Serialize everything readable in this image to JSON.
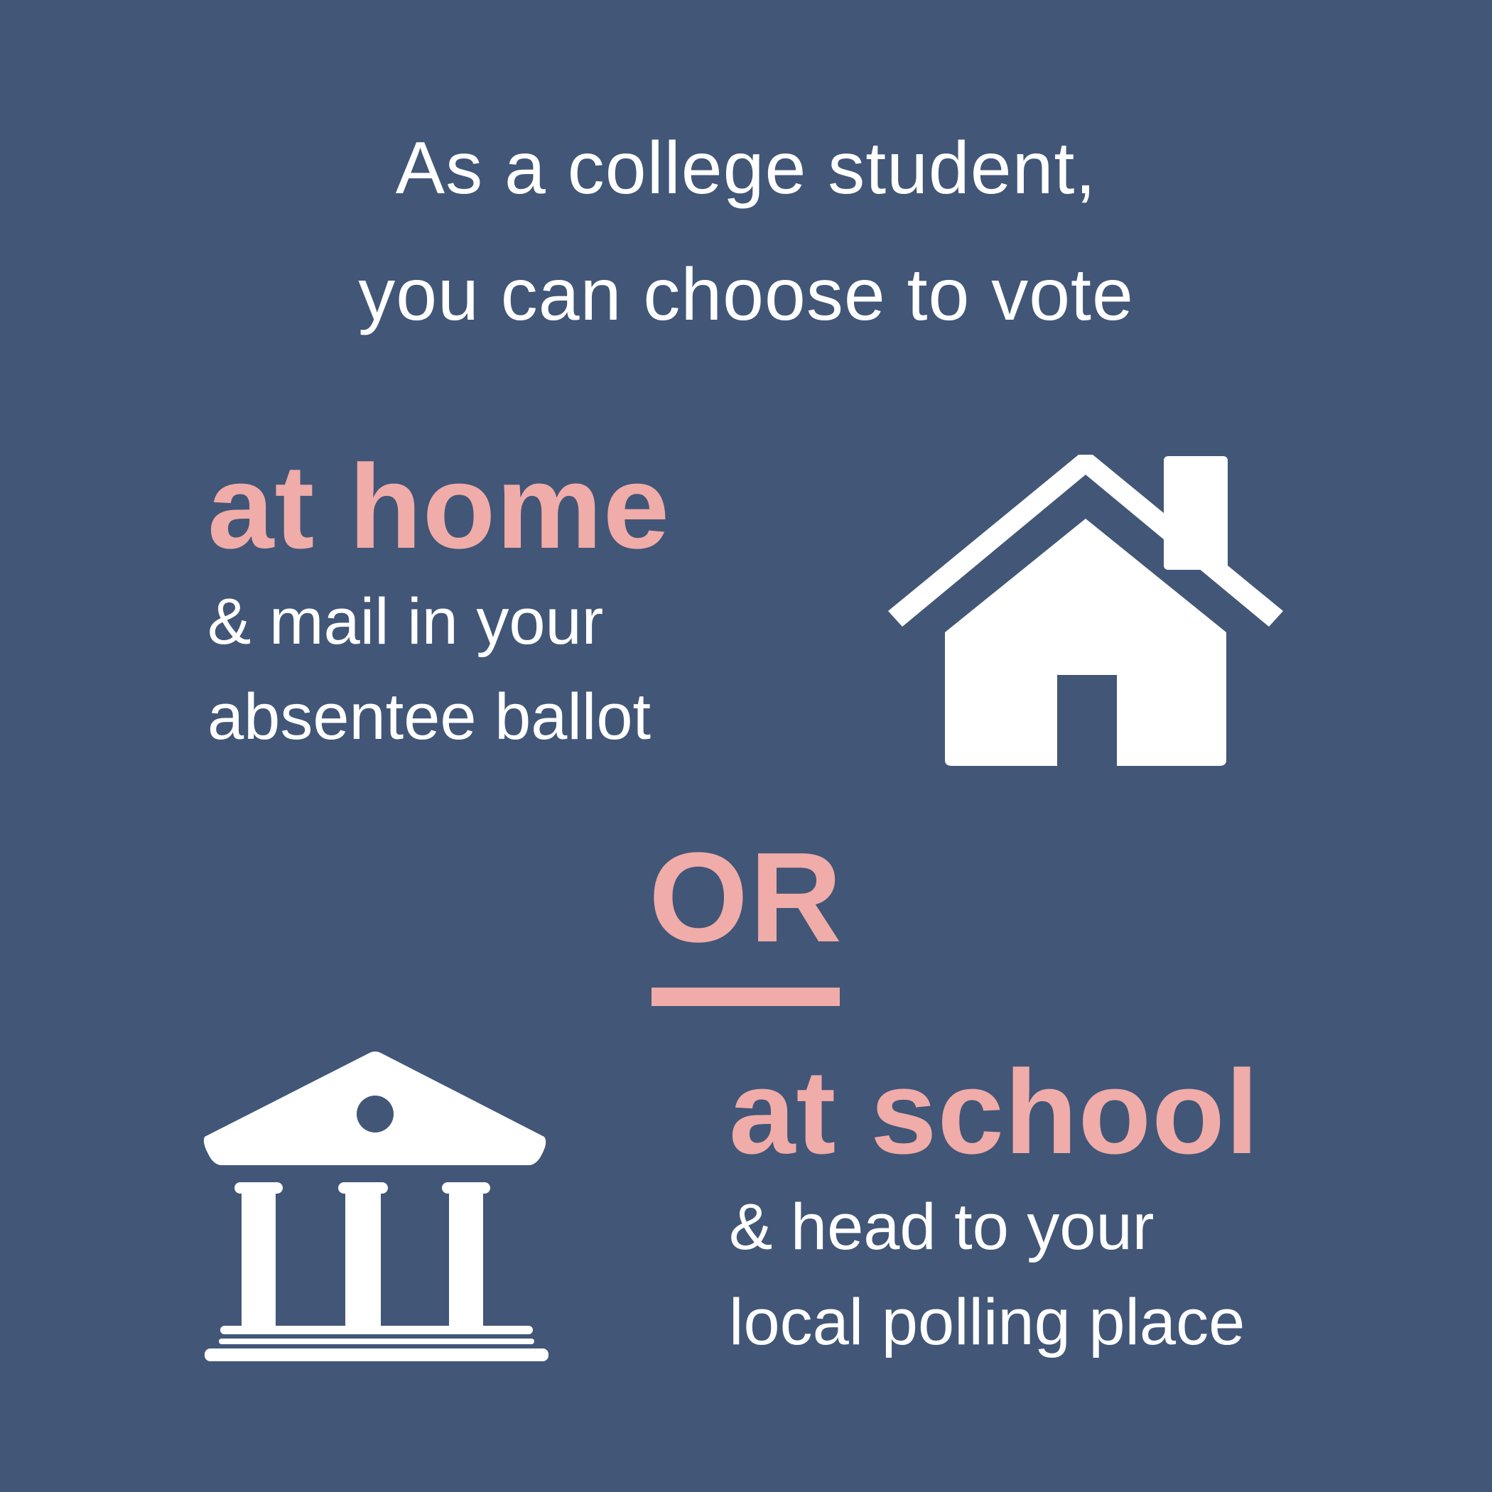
{
  "intro": {
    "line1": "As a college student,",
    "line2": "you can choose to vote"
  },
  "home_option": {
    "heading": "at home",
    "line1": "& mail in your",
    "line2": "absentee ballot",
    "icon": "house-icon"
  },
  "separator": {
    "label": "OR"
  },
  "school_option": {
    "heading": "at school",
    "line1": "& head to your",
    "line2": "local polling place",
    "icon": "government-building-icon"
  },
  "colors": {
    "background": "#425677",
    "accent": "#f0aca8",
    "text": "#ffffff"
  }
}
